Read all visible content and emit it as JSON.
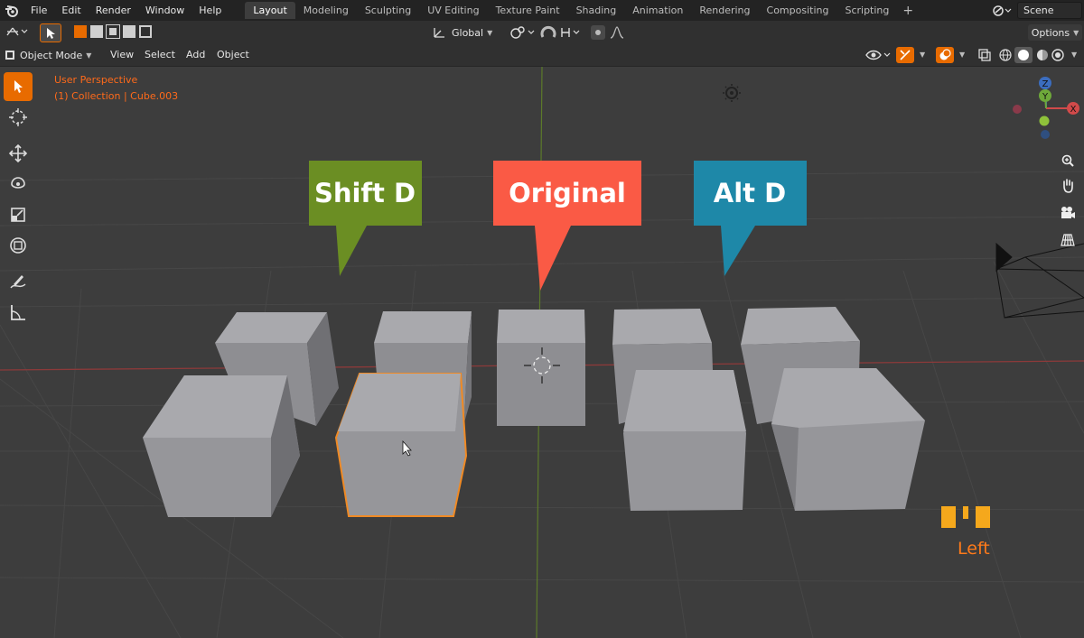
{
  "menu": {
    "items": [
      "File",
      "Edit",
      "Render",
      "Window",
      "Help"
    ]
  },
  "workspaces": {
    "tabs": [
      "Layout",
      "Modeling",
      "Sculpting",
      "UV Editing",
      "Texture Paint",
      "Shading",
      "Animation",
      "Rendering",
      "Compositing",
      "Scripting"
    ],
    "active": "Layout"
  },
  "scene": {
    "name": "Scene"
  },
  "toolbar": {
    "orientation": "Global",
    "options": "Options"
  },
  "viewport_header": {
    "mode": "Object Mode",
    "menus": [
      "View",
      "Select",
      "Add",
      "Object"
    ]
  },
  "overlay": {
    "perspective": "User Perspective",
    "collection": "(1) Collection | Cube.003"
  },
  "callouts": {
    "shift_d": {
      "label": "Shift D",
      "color": "#6b8e23"
    },
    "original": {
      "label": "Original",
      "color": "#fa5a45"
    },
    "alt_d": {
      "label": "Alt D",
      "color": "#1e88a8"
    }
  },
  "mouse": {
    "label": "Left"
  },
  "colors": {
    "accent": "#e86b00",
    "selection": "#f08a24",
    "cube": "#9b9b9f",
    "axis_red": "#d14a4a"
  }
}
